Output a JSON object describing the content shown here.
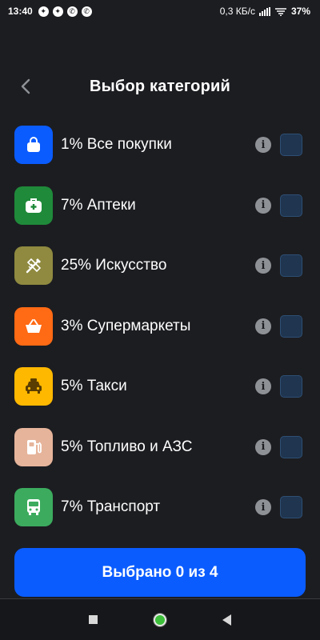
{
  "status_bar": {
    "time": "13:40",
    "network_speed": "0,3 КБ/с",
    "battery": "37%"
  },
  "header": {
    "title": "Выбор категорий"
  },
  "categories": [
    {
      "label": "1% Все покупки",
      "icon": "shopping-bag-icon",
      "color": "#0a5cff"
    },
    {
      "label": "7% Аптеки",
      "icon": "first-aid-kit-icon",
      "color": "#1f8a3a"
    },
    {
      "label": "25% Искусство",
      "icon": "art-tools-icon",
      "color": "#8f8a3f"
    },
    {
      "label": "3% Супермаркеты",
      "icon": "shopping-basket-icon",
      "color": "#ff6a14"
    },
    {
      "label": "5% Такси",
      "icon": "taxi-icon",
      "color": "#ffb800"
    },
    {
      "label": "5% Топливо и АЗС",
      "icon": "fuel-pump-icon",
      "color": "#e6b49b"
    },
    {
      "label": "7% Транспорт",
      "icon": "bus-icon",
      "color": "#3cab5e"
    }
  ],
  "submit": {
    "label": "Выбрано 0 из 4"
  },
  "colors": {
    "background": "#1c1d21",
    "accent": "#0a5cff",
    "checkbox": "#1f3550"
  }
}
